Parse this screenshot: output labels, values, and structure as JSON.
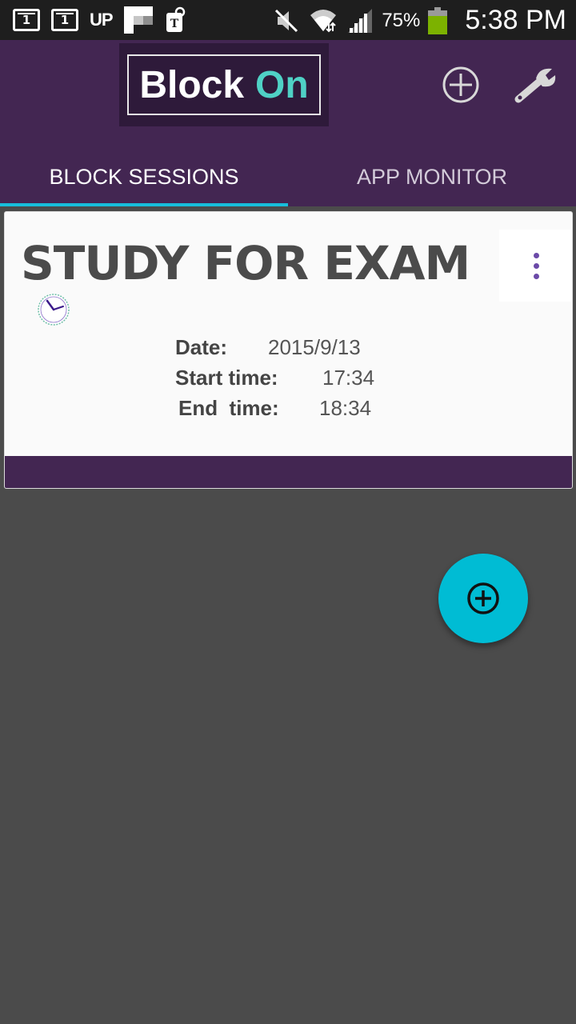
{
  "status_bar": {
    "calendar_1": "1",
    "calendar_2": "1",
    "up_label": "UP",
    "battery_percent": "75%",
    "battery_level": 0.75,
    "time": "5:38 PM",
    "icons": [
      "calendar-icon",
      "calendar-icon",
      "flipboard-icon",
      "tmobile-icon",
      "mute-icon",
      "wifi-icon",
      "signal-icon",
      "battery-icon"
    ]
  },
  "header": {
    "logo_word1": "Block",
    "logo_word2": "On",
    "add_icon": "plus-circle-icon",
    "settings_icon": "wrench-icon",
    "colors": {
      "bar": "#432652",
      "logo_accent": "#4fd1c5",
      "tab_indicator": "#17bedb"
    }
  },
  "tabs": [
    {
      "label": "BLOCK SESSIONS",
      "active": true
    },
    {
      "label": "APP MONITOR",
      "active": false
    }
  ],
  "session": {
    "title": "STUDY FOR EXAM",
    "date_label": "Date:",
    "date_value": "2015/9/13",
    "start_label": "Start time:",
    "start_value": "17:34",
    "end_label": "End  time:",
    "end_value": "18:34",
    "menu_icon": "more-vert-icon",
    "clock_icon": "clock-icon"
  },
  "fab": {
    "icon": "plus-circle-icon",
    "color": "#00bcd4"
  }
}
